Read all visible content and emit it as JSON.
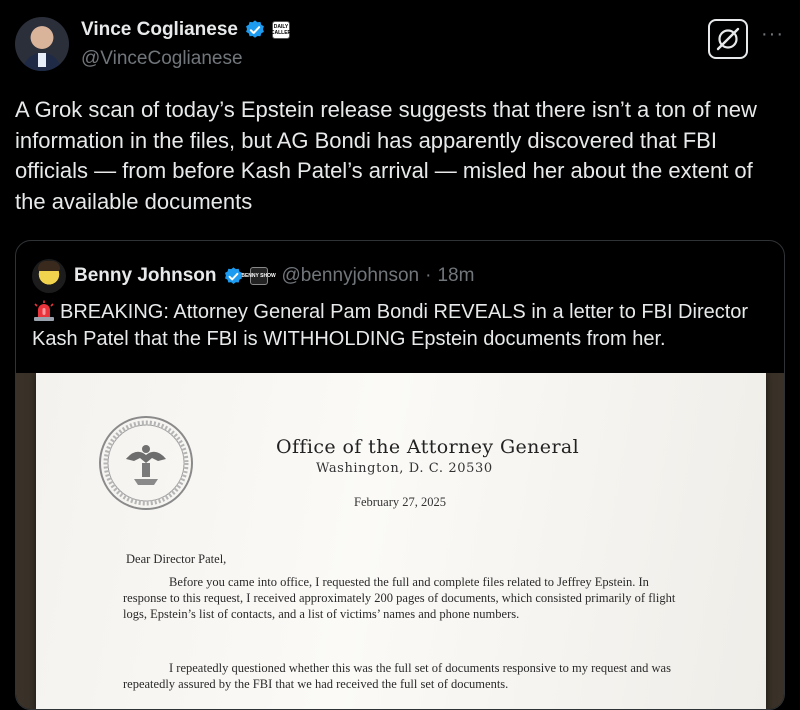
{
  "author": {
    "display_name": "Vince Coglianese",
    "handle": "@VinceCoglianese",
    "affiliation_badge": "DAILY CALLER"
  },
  "tweet": {
    "text": "A Grok scan of today’s Epstein release suggests that there isn’t a ton of new information in the files, but AG Bondi has apparently discovered that FBI officials — from before Kash Patel’s arrival — misled her about the extent of the available documents"
  },
  "actions": {
    "grok_icon": "grok-icon",
    "more_label": "···"
  },
  "quote": {
    "display_name": "Benny Johnson",
    "handle": "@bennyjohnson",
    "separator": "·",
    "time": "18m",
    "affiliation_badge": "BENNY SHOW",
    "text": "BREAKING: Attorney General Pam Bondi REVEALS in a letter to FBI Director Kash Patel that the FBI is WITHHOLDING Epstein documents from her.",
    "emoji_icon": "police-light-icon"
  },
  "letter": {
    "letterhead": "Office of the Attorney General",
    "address": "Washington, D. C. 20530",
    "date": "February 27, 2025",
    "salutation": "Dear Director Patel,",
    "paragraph1": "Before you came into office, I requested the full and complete files related to Jeffrey Epstein. In response to this request, I received approximately 200 pages of documents, which consisted primarily of flight logs, Epstein’s list of contacts, and a list of victims’ names and phone numbers.",
    "paragraph2": "I repeatedly questioned whether this was the full set of documents responsive to my request and was repeatedly assured by the FBI that we had received the full set of documents."
  },
  "colors": {
    "background": "#000000",
    "text": "#e7e9ea",
    "muted": "#71767b",
    "verified": "#1d9bf0",
    "border": "#2f3336"
  }
}
